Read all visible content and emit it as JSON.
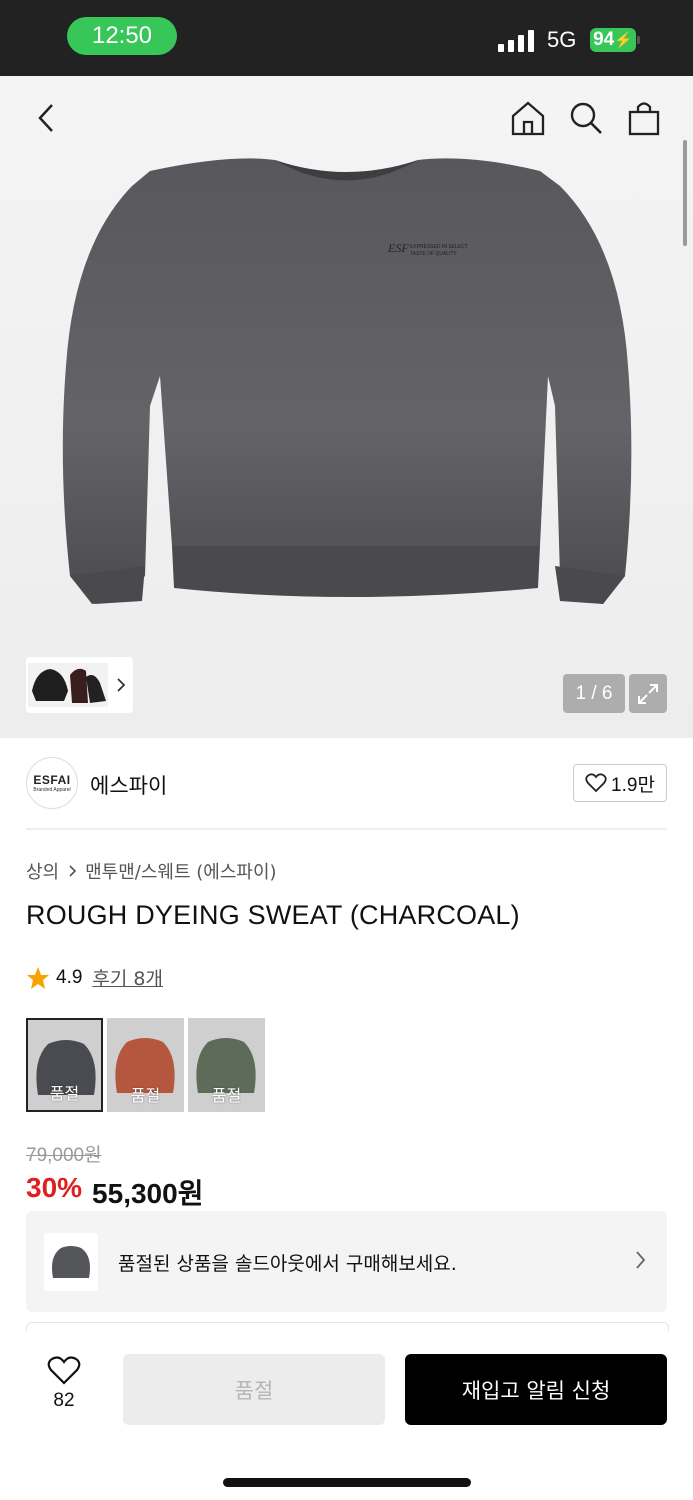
{
  "status_bar": {
    "time": "12:50",
    "network": "5G",
    "battery": "94"
  },
  "gallery": {
    "counter": "1 / 6"
  },
  "brand": {
    "logo_text": "ESFAI",
    "logo_subtext": "Branded Apparel",
    "name": "에스파이",
    "likes": "1.9만"
  },
  "breadcrumb": {
    "category": "상의",
    "subcategory": "맨투맨/스웨트 (에스파이)"
  },
  "product": {
    "title": "ROUGH DYEING SWEAT (CHARCOAL)",
    "rating": "4.9",
    "reviews": "후기 8개"
  },
  "swatches": [
    {
      "label": "품절",
      "color": "#4a4b50"
    },
    {
      "label": "품절",
      "color": "#b5573e"
    },
    {
      "label": "품절",
      "color": "#5d6b58"
    }
  ],
  "price": {
    "original": "79,000원",
    "discount": "30%",
    "sale": "55,300원"
  },
  "soldout_banner": {
    "message": "품절된 상품을 솔드아웃에서 구매해보세요."
  },
  "bottom_bar": {
    "wish_count": "82",
    "soldout_label": "품절",
    "restock_label": "재입고 알림 신청"
  },
  "colors": {
    "accent_red": "#e02020",
    "status_green": "#37c759"
  }
}
